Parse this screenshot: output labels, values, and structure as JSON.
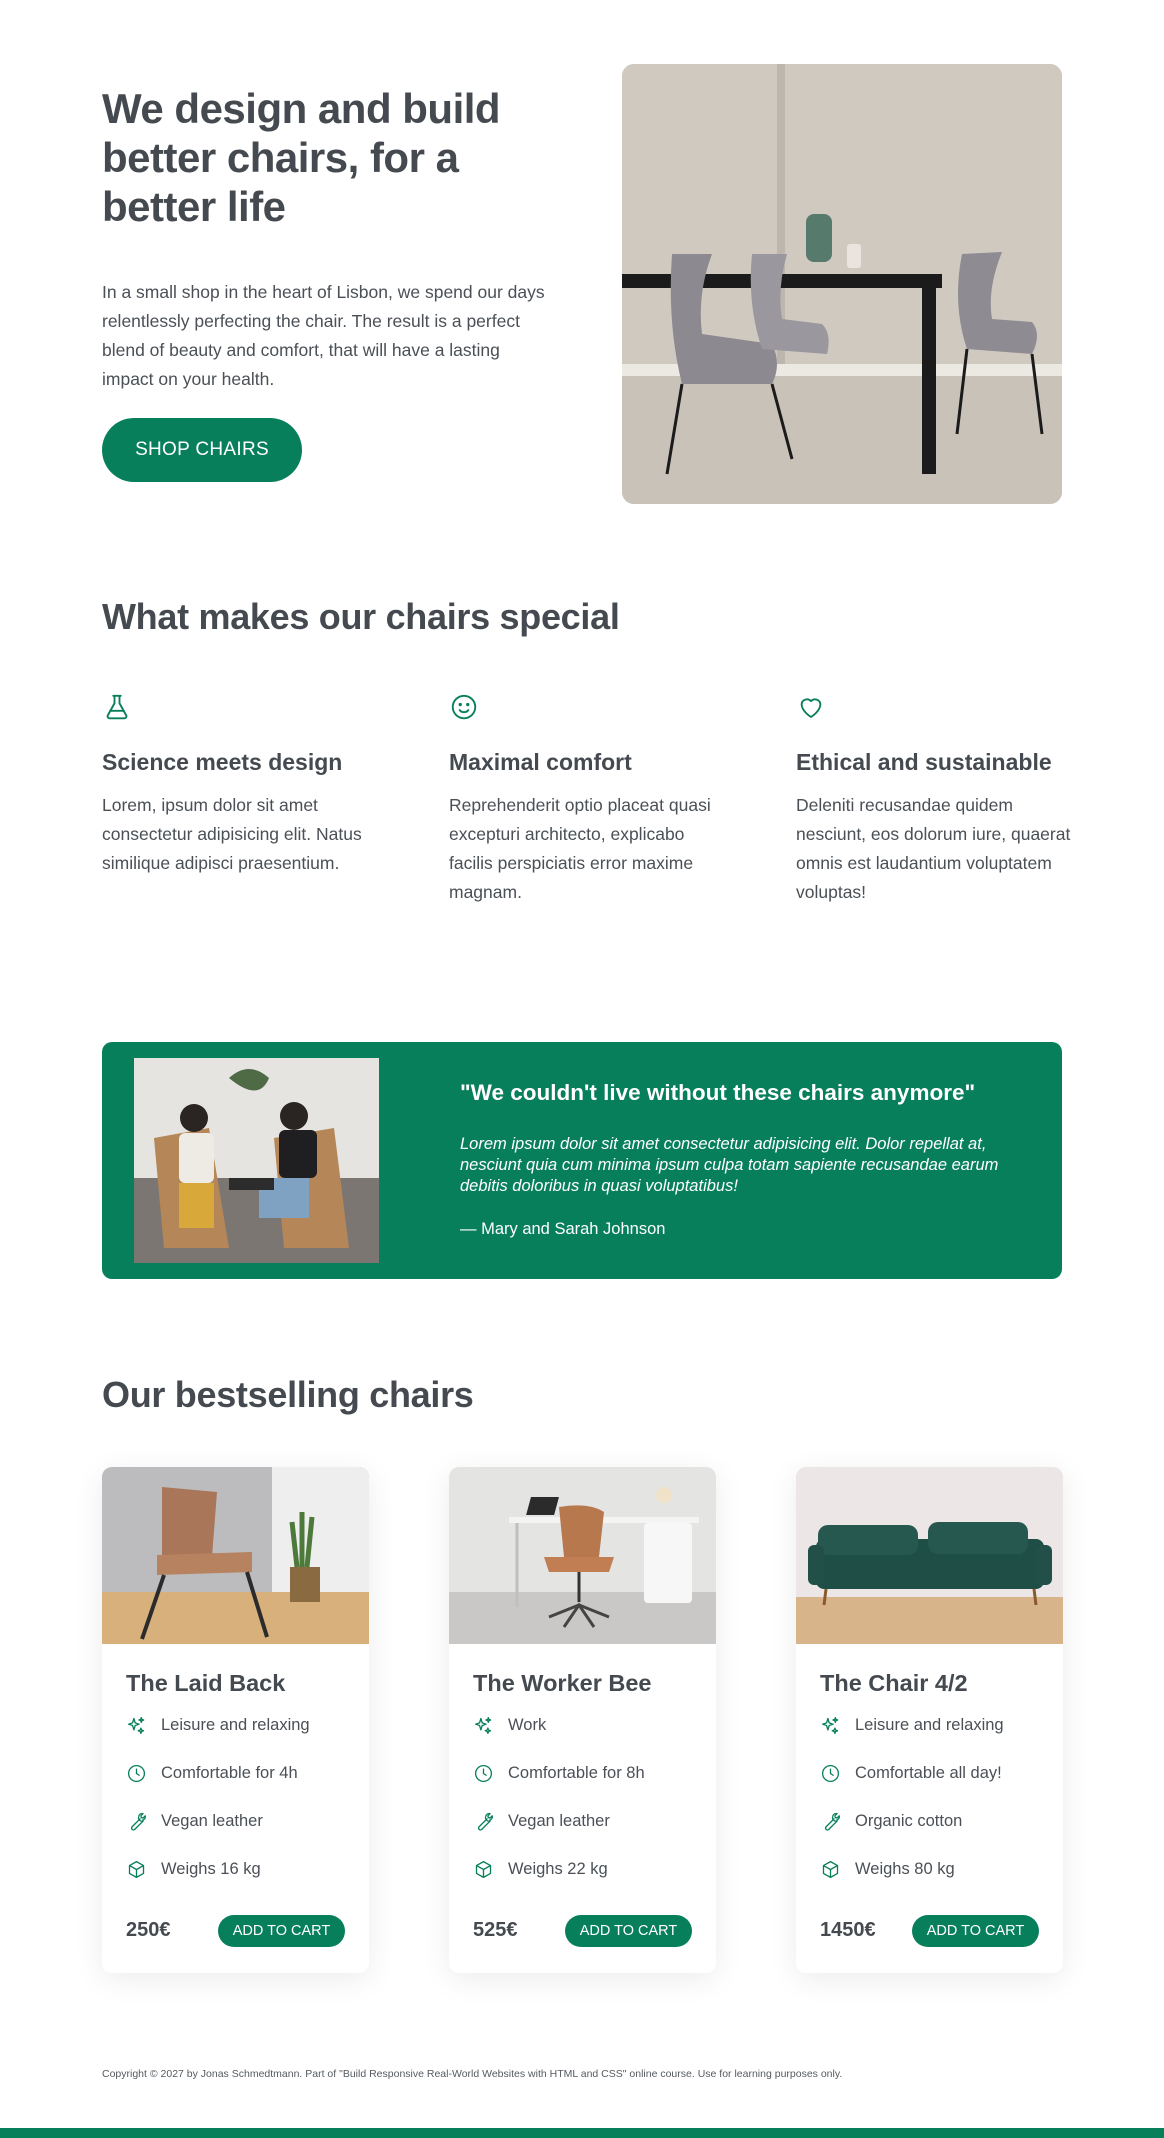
{
  "hero": {
    "title": "We design and build better chairs, for a better life",
    "text": "In a small shop in the heart of Lisbon, we spend our days relentlessly perfecting the chair. The result is a perfect blend of beauty and comfort, that will have a lasting impact on your health.",
    "cta_label": "SHOP CHAIRS"
  },
  "features": {
    "title": "What makes our chairs special",
    "items": [
      {
        "icon": "flask-icon",
        "title": "Science meets design",
        "text": "Lorem, ipsum dolor sit amet consectetur adipisicing elit. Natus similique adipisci praesentium."
      },
      {
        "icon": "smile-icon",
        "title": "Maximal comfort",
        "text": "Reprehenderit optio placeat quasi excepturi architecto, explicabo facilis perspiciatis error maxime magnam."
      },
      {
        "icon": "heart-icon",
        "title": "Ethical and sustainable",
        "text": "Deleniti recusandae quidem nesciunt, eos dolorum iure, quaerat omnis est laudantium voluptatem voluptas!"
      }
    ]
  },
  "testimonial": {
    "quote": "\"We couldn't live without these chairs anymore\"",
    "text": "Lorem ipsum dolor sit amet consectetur adipisicing elit. Dolor repellat at, nesciunt quia cum minima ipsum culpa totam sapiente recusandae earum debitis doloribus in quasi voluptatibus!",
    "author": "— Mary and Sarah Johnson"
  },
  "bestsellers": {
    "title": "Our bestselling chairs",
    "products": [
      {
        "name": "The Laid Back",
        "attrs": [
          "Leisure and relaxing",
          "Comfortable for 4h",
          "Vegan leather",
          "Weighs 16 kg"
        ],
        "price": "250€",
        "button": "ADD TO CART"
      },
      {
        "name": "The Worker Bee",
        "attrs": [
          "Work",
          "Comfortable for 8h",
          "Vegan leather",
          "Weighs 22 kg"
        ],
        "price": "525€",
        "button": "ADD TO CART"
      },
      {
        "name": "The Chair 4/2",
        "attrs": [
          "Leisure and relaxing",
          "Comfortable all day!",
          "Organic cotton",
          "Weighs 80 kg"
        ],
        "price": "1450€",
        "button": "ADD TO CART"
      }
    ],
    "attr_icons": [
      "sparkles-icon",
      "clock-icon",
      "wrench-icon",
      "cube-icon"
    ]
  },
  "footer": {
    "copyright": "Copyright © 2027 by Jonas Schmedtmann. Part of \"Build Responsive Real-World Websites with HTML and CSS\" online course. Use for learning purposes only."
  },
  "colors": {
    "accent": "#087f5b",
    "text": "#454a50"
  }
}
